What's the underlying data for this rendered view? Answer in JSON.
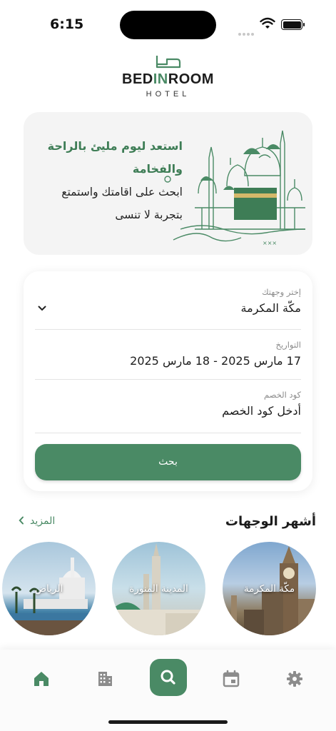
{
  "status": {
    "time": "6:15"
  },
  "logo": {
    "name_prefix": "BED",
    "name_highlight": "IN",
    "name_suffix": "ROOM",
    "subtitle": "HOTEL"
  },
  "banner": {
    "title_line1": "استعد ليوم مليئ بالراحة",
    "title_line2": "والفخامة",
    "subtitle_line1": "ابحث على اقامتك واستمتع",
    "subtitle_line2": "بتجربة لا تنسى"
  },
  "search": {
    "destination_label": "إختر وجهتك",
    "destination_value": "مكّة المكرمة",
    "dates_label": "التواريخ",
    "dates_value": "17 مارس 2025 - 18 مارس 2025",
    "discount_label": "كود الخصم",
    "discount_placeholder": "أدخل كود الخصم",
    "button_label": "بحث"
  },
  "popular": {
    "title": "أشهر الوجهات",
    "more_label": "المزيد",
    "cities": [
      {
        "name": "مكّة المكرمة"
      },
      {
        "name": "المدينة المنورة"
      },
      {
        "name": "الرياض"
      }
    ]
  },
  "nav": {
    "items": [
      "home-icon",
      "buildings-icon",
      "search-icon",
      "calendar-icon",
      "settings-icon"
    ],
    "active": "home-icon"
  },
  "colors": {
    "accent": "#4a8a65",
    "background": "#ffffff",
    "card": "#f4f4f4"
  }
}
